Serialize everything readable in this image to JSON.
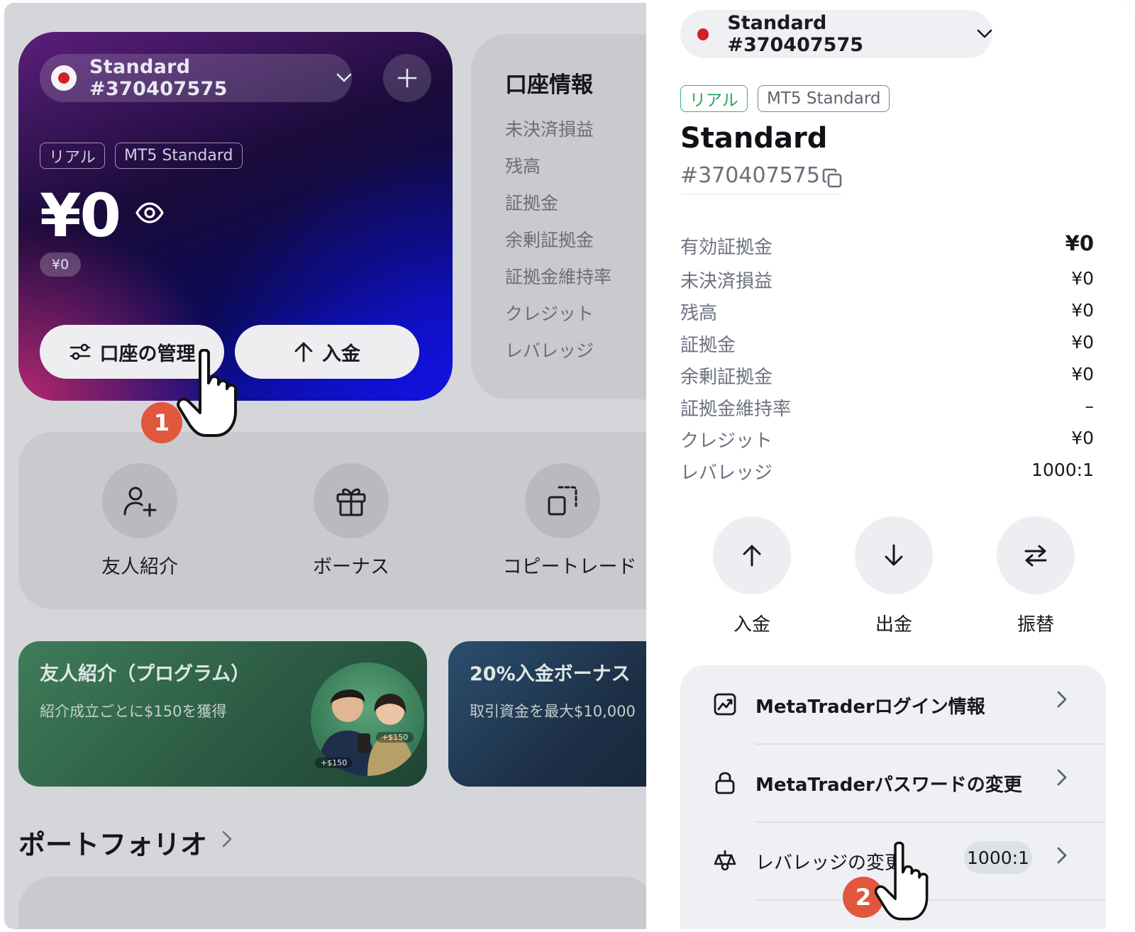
{
  "colors": {
    "accent_red": "#d0202a",
    "badge_orange": "#e0573e",
    "real_green": "#27a35b",
    "card_purple": "#1a0b3a",
    "card_blue": "#1212e0"
  },
  "left": {
    "account_card": {
      "account_selector": "Standard #370407575",
      "tag_real": "リアル",
      "tag_type": "MT5 Standard",
      "balance": "¥0",
      "sub_balance": "¥0",
      "manage_button": "口座の管理",
      "deposit_button": "入金"
    },
    "info_card": {
      "title": "口座情報",
      "rows": [
        "未決済損益",
        "残高",
        "証拠金",
        "余剰証拠金",
        "証拠金維持率",
        "クレジット",
        "レバレッジ"
      ]
    },
    "quick_actions": [
      {
        "label": "友人紹介",
        "icon": "user-add-icon"
      },
      {
        "label": "ボーナス",
        "icon": "gift-icon"
      },
      {
        "label": "コピートレード",
        "icon": "copy-trade-icon"
      }
    ],
    "promos": [
      {
        "title": "友人紹介（プログラム）",
        "subtitle": "紹介成立ごとに$150を獲得",
        "chip1": "+$150",
        "chip2": "+$150"
      },
      {
        "title": "20%入金ボーナス",
        "subtitle": "取引資金を最大$10,000"
      }
    ],
    "portfolio_title": "ポートフォリオ"
  },
  "right": {
    "account_selector": "Standard #370407575",
    "tag_real": "リアル",
    "tag_type": "MT5 Standard",
    "account_name": "Standard",
    "account_number": "#370407575",
    "details": [
      {
        "label": "有効証拠金",
        "value": "¥0"
      },
      {
        "label": "未決済損益",
        "value": "¥0"
      },
      {
        "label": "残高",
        "value": "¥0"
      },
      {
        "label": "証拠金",
        "value": "¥0"
      },
      {
        "label": "余剰証拠金",
        "value": "¥0"
      },
      {
        "label": "証拠金維持率",
        "value": "–"
      },
      {
        "label": "クレジット",
        "value": "¥0"
      },
      {
        "label": "レバレッジ",
        "value": "1000:1"
      }
    ],
    "actions": [
      {
        "label": "入金",
        "icon": "arrow-up-icon"
      },
      {
        "label": "出金",
        "icon": "arrow-down-icon"
      },
      {
        "label": "振替",
        "icon": "transfer-icon"
      }
    ],
    "menu": [
      {
        "label": "MetaTraderログイン情報",
        "icon": "chart-icon"
      },
      {
        "label": "MetaTraderパスワードの変更",
        "icon": "lock-icon"
      },
      {
        "label": "レバレッジの変更",
        "icon": "scale-icon",
        "badge": "1000:1"
      }
    ]
  },
  "steps": [
    "1",
    "2"
  ]
}
